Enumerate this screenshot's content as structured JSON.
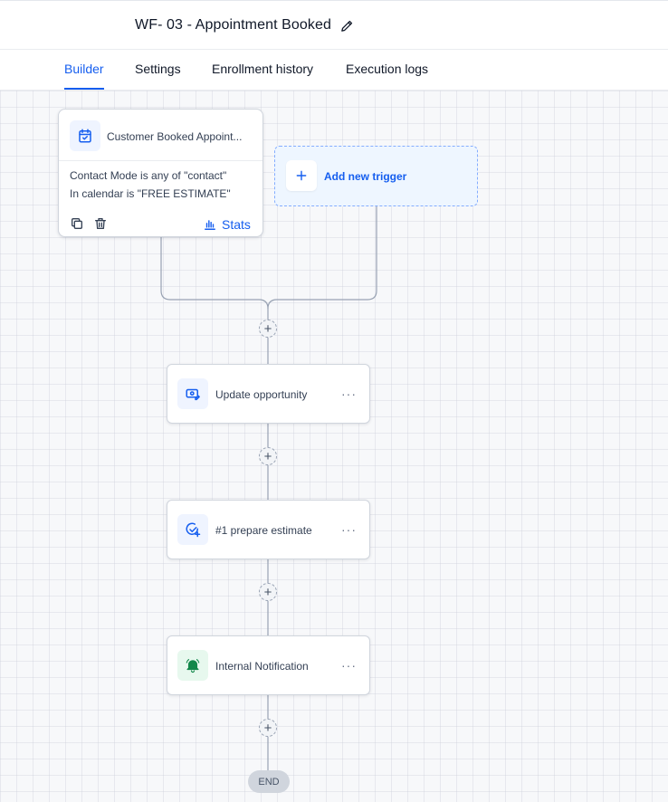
{
  "header": {
    "title": "WF- 03 - Appointment Booked",
    "edit_icon": "pencil-icon"
  },
  "tabs": [
    {
      "label": "Builder",
      "active": true
    },
    {
      "label": "Settings",
      "active": false
    },
    {
      "label": "Enrollment history",
      "active": false
    },
    {
      "label": "Execution logs",
      "active": false
    }
  ],
  "trigger": {
    "icon": "calendar-check-icon",
    "title": "Customer Booked Appoint...",
    "conditions": [
      "Contact Mode is any of \"contact\"",
      "In calendar is \"FREE ESTIMATE\""
    ],
    "copy_icon": "copy-icon",
    "delete_icon": "trash-icon",
    "stats_icon": "bar-chart-icon",
    "stats_label": "Stats"
  },
  "add_trigger": {
    "icon": "plus-icon",
    "label": "Add new trigger"
  },
  "actions": [
    {
      "icon": "opportunity-icon",
      "label": "Update opportunity",
      "menu": "···"
    },
    {
      "icon": "task-check-icon",
      "label": "#1 prepare estimate",
      "menu": "···"
    },
    {
      "icon": "bell-icon",
      "label": "Internal Notification",
      "menu": "···"
    }
  ],
  "plus_symbol": "+",
  "end_label": "END",
  "colors": {
    "accent": "#155eef",
    "notification_green": "#12874a",
    "canvas_bg": "#f7f8fa"
  }
}
